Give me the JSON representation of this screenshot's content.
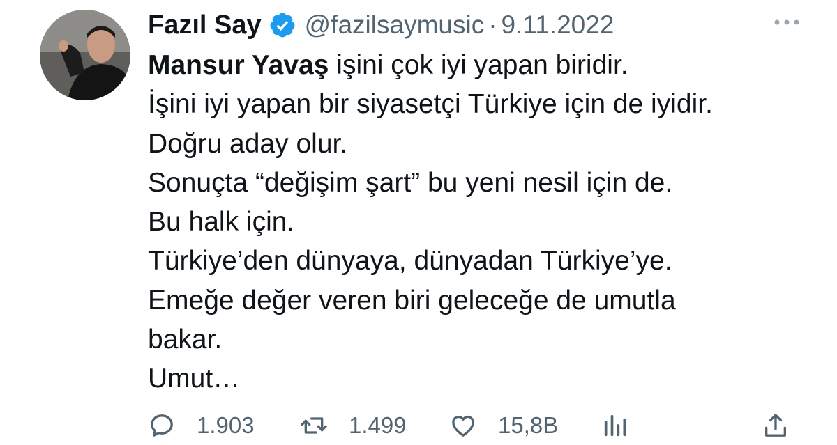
{
  "tweet": {
    "author": {
      "display_name": "Fazıl Say",
      "handle": "@fazilsaymusic",
      "verified": true,
      "avatar_icon": "avatar-photo"
    },
    "separator": "·",
    "date": "9.11.2022",
    "body": {
      "first_line_bold": "Mansur Yavaş",
      "first_line_rest": " işini çok iyi yapan biridir.",
      "lines": [
        "İşini iyi yapan bir siyasetçi Türkiye için de iyidir.",
        "Doğru aday  olur.",
        "Sonuçta “değişim şart” bu yeni nesil için de.",
        "Bu halk için.",
        "Türkiye’den dünyaya, dünyadan Türkiye’ye.",
        "Emeğe değer veren biri geleceğe de umutla",
        "bakar.",
        "Umut…"
      ]
    },
    "actions": {
      "replies": "1.903",
      "retweets": "1.499",
      "likes": "15,8B"
    }
  },
  "colors": {
    "text_primary": "#0f1419",
    "text_secondary": "#536471",
    "verified_blue": "#1d9bf0"
  },
  "icons": {
    "verified": "verified-badge-icon",
    "more": "more-options-icon",
    "reply": "reply-icon",
    "retweet": "retweet-icon",
    "like": "heart-icon",
    "views": "analytics-icon",
    "share": "share-icon"
  }
}
